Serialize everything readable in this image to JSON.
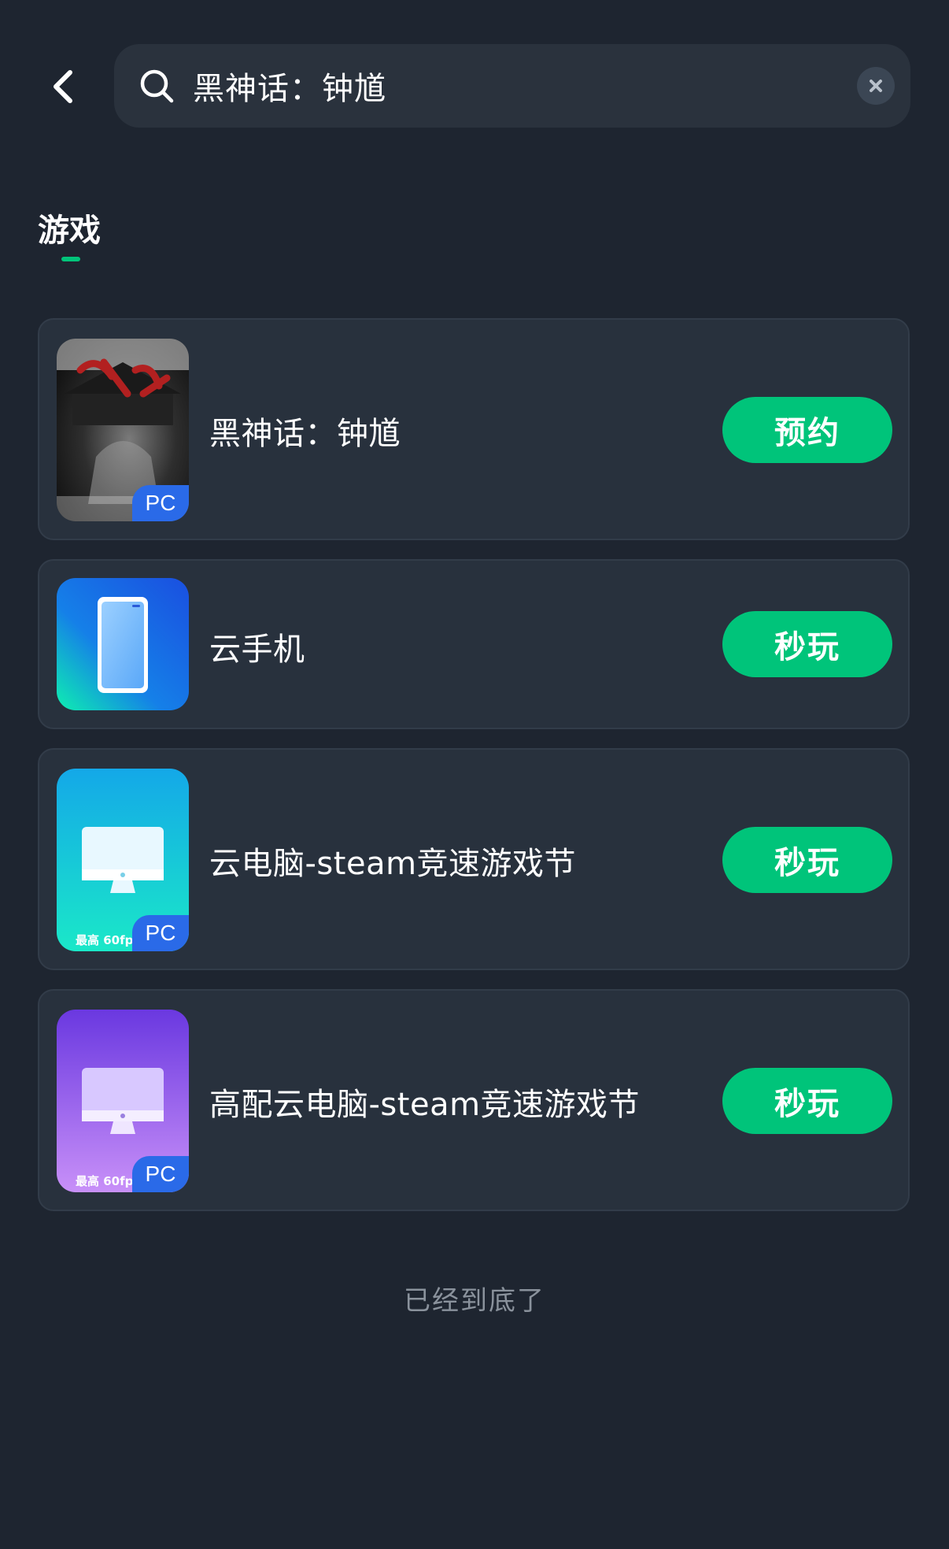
{
  "header": {
    "search_query": "黑神话：钟馗"
  },
  "tabs": {
    "games_label": "游戏"
  },
  "results": [
    {
      "title": "黑神话：钟馗",
      "action": "预约",
      "badge": "PC",
      "fps_label": ""
    },
    {
      "title": "云手机",
      "action": "秒玩",
      "badge": "",
      "fps_label": ""
    },
    {
      "title": "云电脑-steam竞速游戏节",
      "action": "秒玩",
      "badge": "PC",
      "fps_label": "最高 60fps"
    },
    {
      "title": "高配云电脑-steam竞速游戏节",
      "action": "秒玩",
      "badge": "PC",
      "fps_label": "最高 60fps"
    }
  ],
  "footer": {
    "end_text": "已经到底了"
  },
  "icons": {
    "back": "chevron-left-icon",
    "search": "search-icon",
    "clear": "close-icon"
  },
  "colors": {
    "background": "#1e2530",
    "card": "#28313d",
    "accent": "#00c47a",
    "badge": "#2a6ae8"
  }
}
